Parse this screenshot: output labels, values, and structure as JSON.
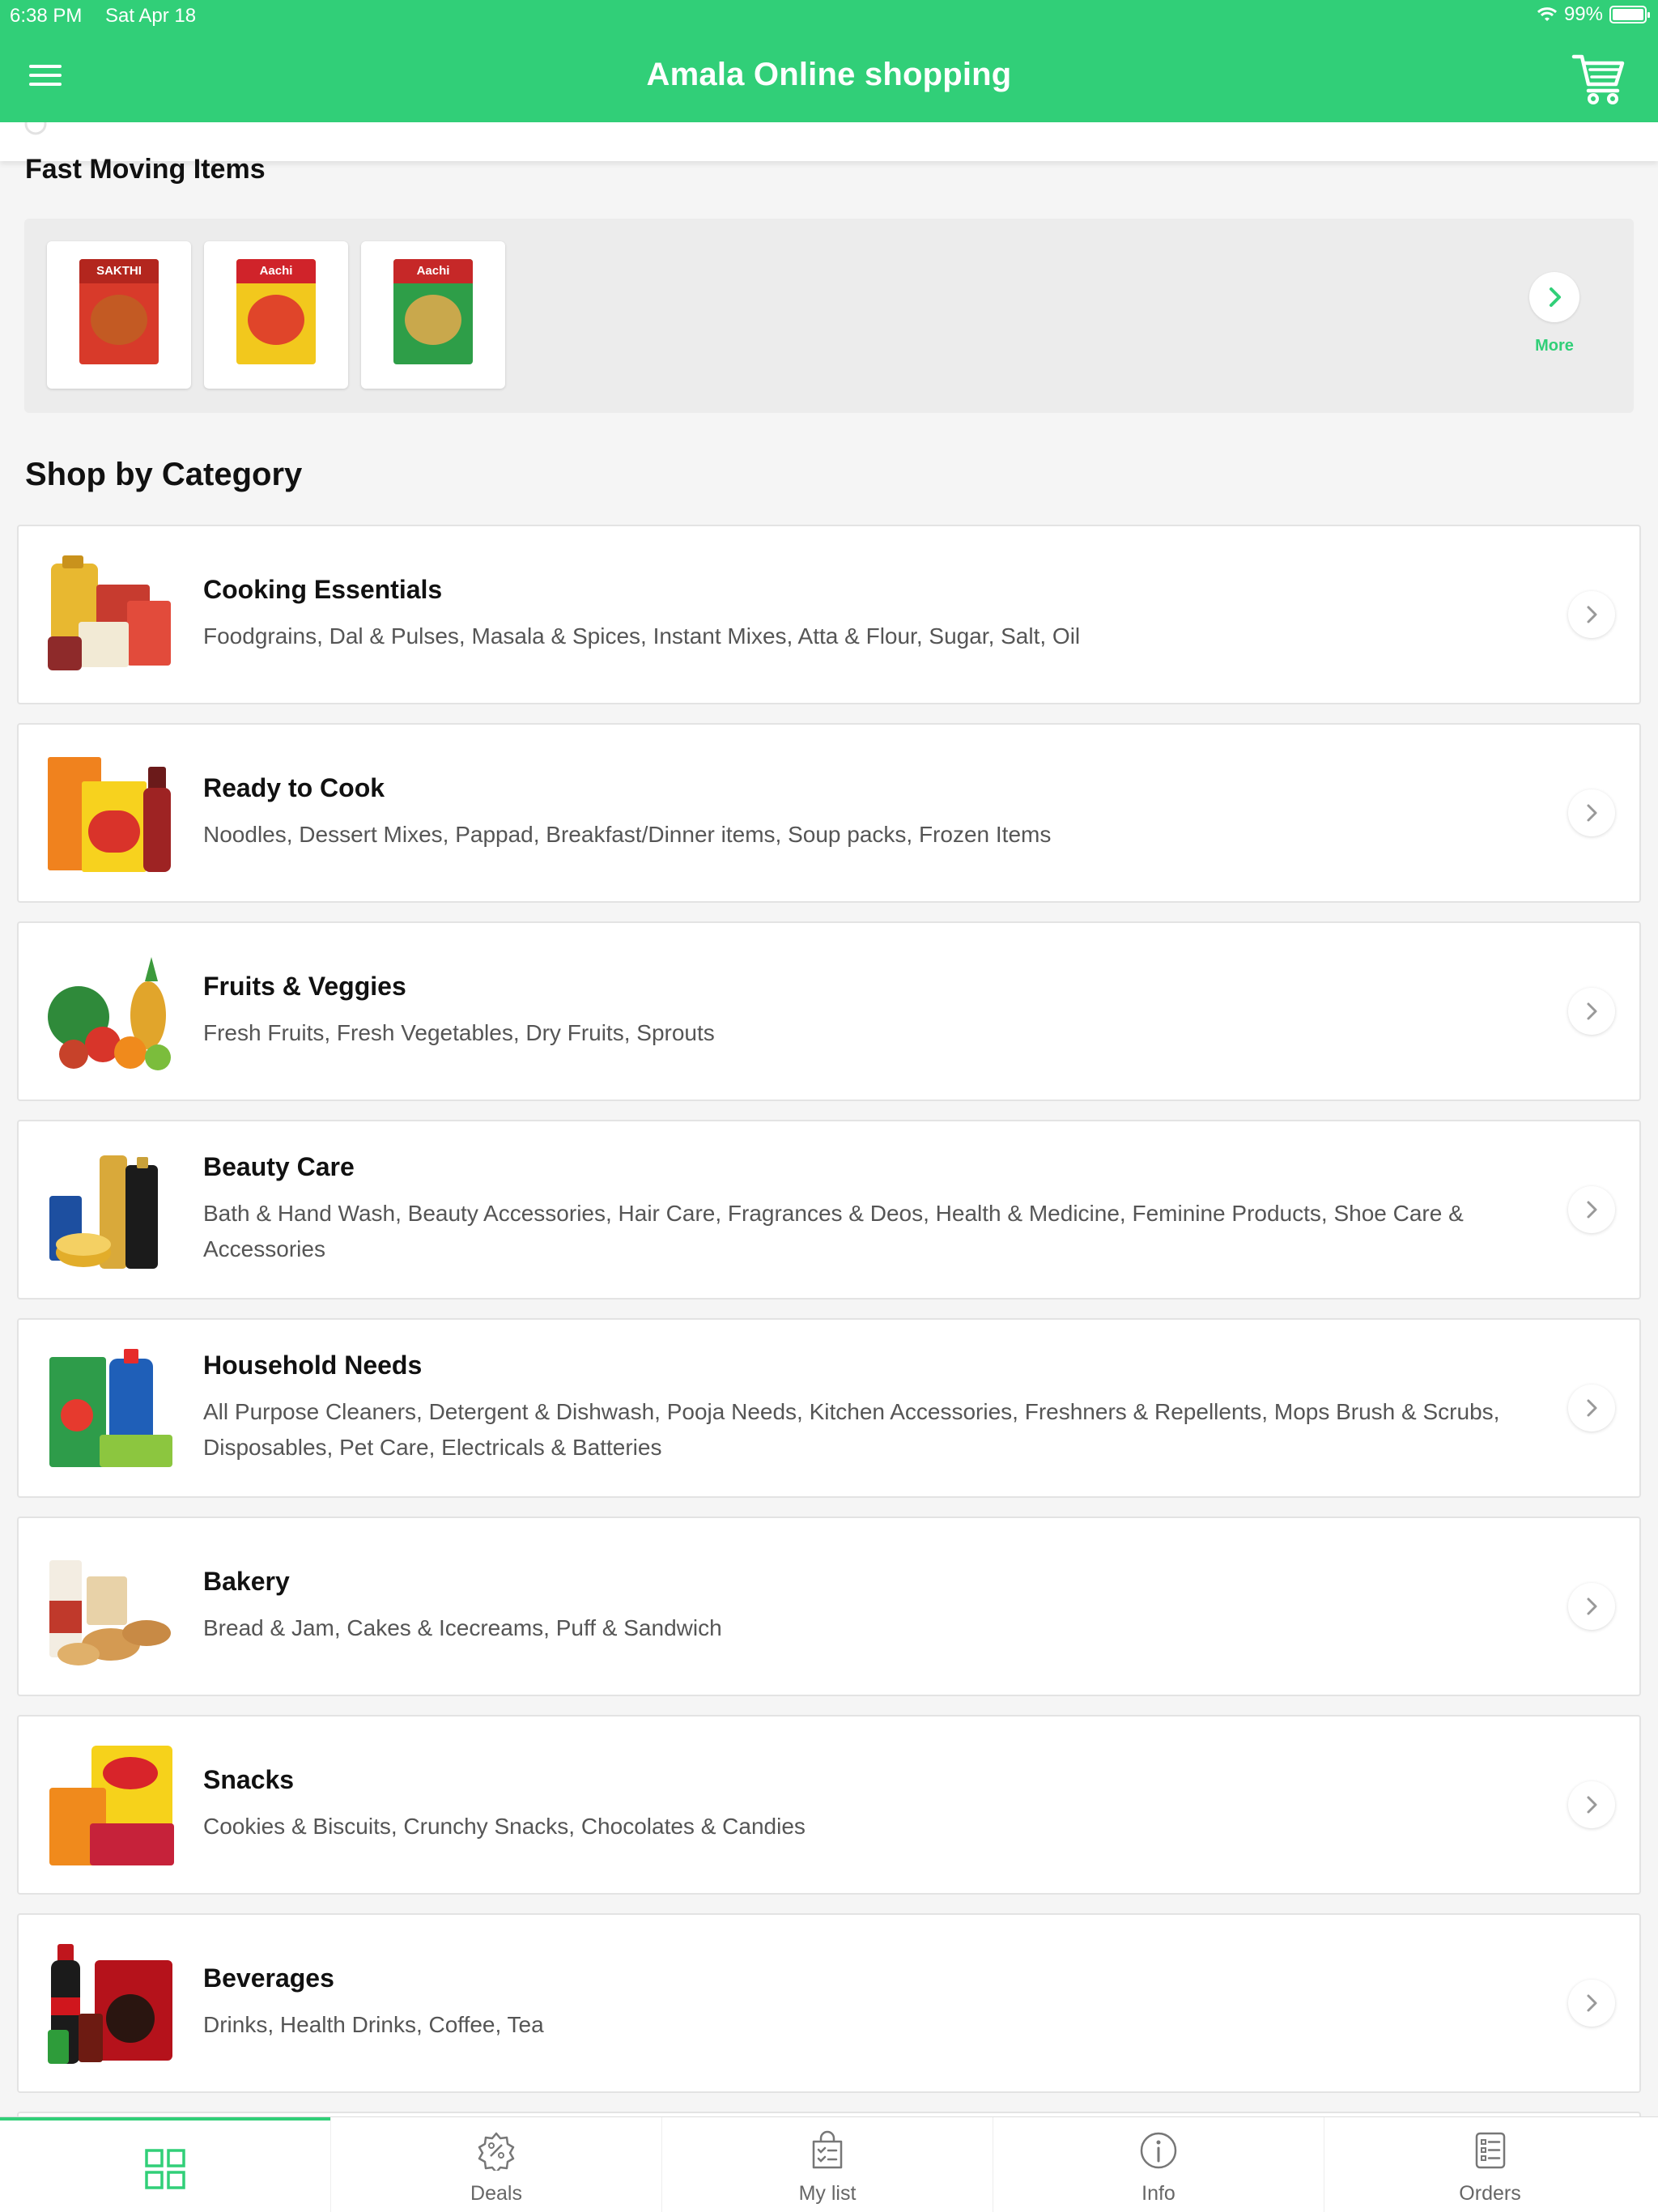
{
  "status_bar": {
    "time": "6:38 PM",
    "date": "Sat Apr 18",
    "battery": "99%"
  },
  "header": {
    "title": "Amala Online shopping"
  },
  "fast_moving": {
    "title": "Fast Moving Items",
    "items": [
      {
        "brand": "SAKTHI",
        "colors": {
          "band": "#b3261e",
          "body": "#d83a2a",
          "food": "#c35a23"
        }
      },
      {
        "brand": "Aachi",
        "colors": {
          "band": "#d0232a",
          "body": "#f2c81d",
          "food": "#e0452a"
        }
      },
      {
        "brand": "Aachi",
        "colors": {
          "band": "#c62828",
          "body": "#2e9e48",
          "food": "#c9a84c"
        }
      }
    ],
    "more_label": "More"
  },
  "shop_by_category": {
    "title": "Shop by Category",
    "categories": [
      {
        "name": "Cooking Essentials",
        "description": "Foodgrains, Dal & Pulses, Masala & Spices, Instant Mixes, Atta & Flour, Sugar, Salt, Oil"
      },
      {
        "name": "Ready to Cook",
        "description": "Noodles, Dessert Mixes, Pappad, Breakfast/Dinner items, Soup packs, Frozen Items"
      },
      {
        "name": "Fruits & Veggies",
        "description": "Fresh Fruits, Fresh Vegetables, Dry Fruits, Sprouts"
      },
      {
        "name": "Beauty Care",
        "description": "Bath & Hand Wash, Beauty Accessories, Hair Care, Fragrances & Deos, Health & Medicine, Feminine Products, Shoe Care & Accessories"
      },
      {
        "name": "Household Needs",
        "description": "All Purpose Cleaners, Detergent & Dishwash, Pooja Needs, Kitchen Accessories, Freshners & Repellents, Mops Brush & Scrubs, Disposables, Pet Care, Electricals & Batteries"
      },
      {
        "name": "Bakery",
        "description": "Bread & Jam, Cakes & Icecreams, Puff & Sandwich"
      },
      {
        "name": "Snacks",
        "description": "Cookies & Biscuits, Crunchy Snacks, Chocolates & Candies"
      },
      {
        "name": "Beverages",
        "description": "Drinks, Health Drinks, Coffee, Tea"
      }
    ]
  },
  "tabbar": {
    "tabs": [
      {
        "label": "",
        "icon": "grid-icon",
        "active": true
      },
      {
        "label": "Deals",
        "icon": "deals-icon"
      },
      {
        "label": "My list",
        "icon": "list-icon"
      },
      {
        "label": "Info",
        "icon": "info-icon"
      },
      {
        "label": "Orders",
        "icon": "orders-icon"
      }
    ]
  },
  "colors": {
    "brand_green": "#31cf78",
    "text_dark": "#111111",
    "text_muted": "#555555"
  }
}
